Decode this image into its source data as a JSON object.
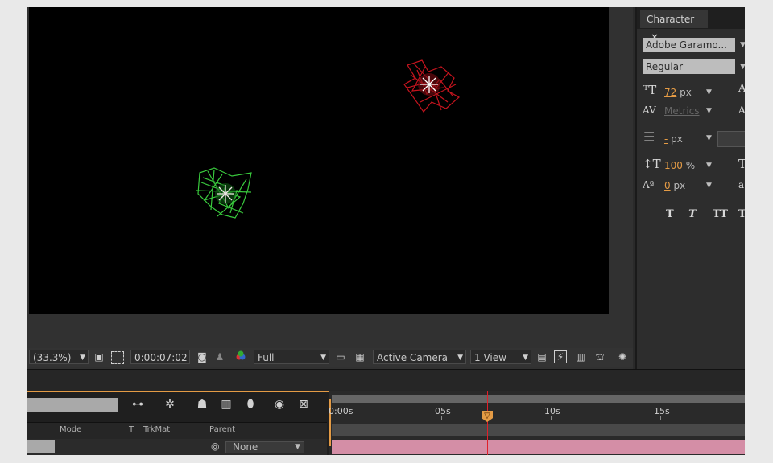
{
  "viewer": {
    "magnification": "(33.3%)",
    "timecode": "0:00:07:02",
    "resolution": "Full",
    "camera": "Active Camera",
    "views": "1 View"
  },
  "character": {
    "tab_label": "Character",
    "font_family": "Adobe Garamo...",
    "font_style": "Regular",
    "font_size": "72",
    "font_size_unit": "px",
    "kerning": "Metrics",
    "stroke_width": "-",
    "stroke_unit": "px",
    "vertical_scale": "100",
    "vertical_scale_unit": "%",
    "baseline_shift": "0",
    "baseline_unit": "px",
    "format_buttons": [
      "T",
      "T",
      "TT",
      "Tт"
    ]
  },
  "timeline": {
    "columns": [
      "Mode",
      "T",
      "TrkMat",
      "Parent"
    ],
    "parent_value": "None",
    "ruler_ticks": [
      "0:00s",
      "05s",
      "10s",
      "15s"
    ],
    "playhead_label": "▽"
  },
  "colors": {
    "accent_orange": "#e49b45",
    "playhead_red": "#e0202a",
    "layer_pink": "#d48ea6",
    "particle_green": "#39c93d",
    "particle_red": "#c4141e"
  }
}
